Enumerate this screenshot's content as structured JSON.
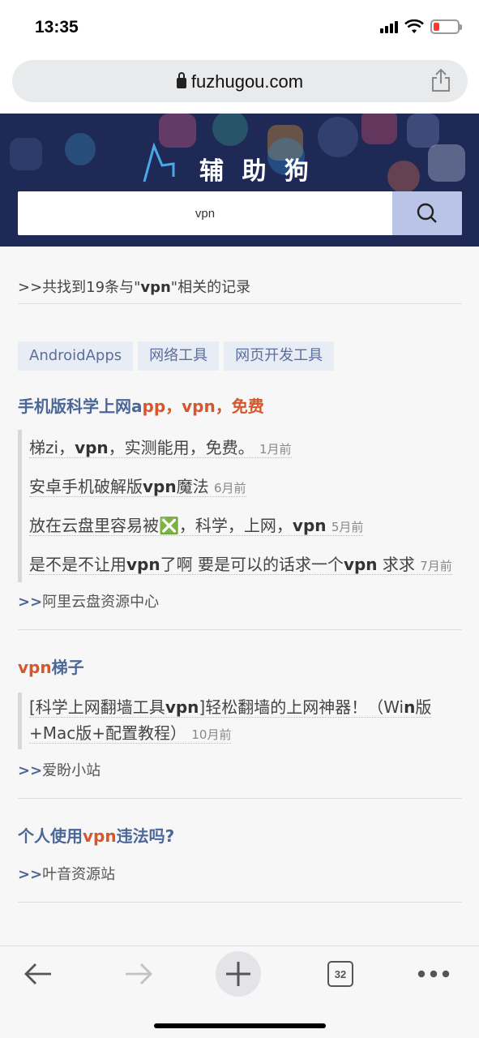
{
  "status": {
    "time": "13:35"
  },
  "browser": {
    "url": "fuzhugou.com",
    "tab_count": "32"
  },
  "site": {
    "brand": "辅 助 狗"
  },
  "search": {
    "value": "vpn"
  },
  "result_count": {
    "prefix": ">>共找到19条与\"",
    "keyword": "vpn",
    "suffix": "\"相关的记录"
  },
  "tags": [
    "AndroidApps",
    "网络工具",
    "网页开发工具"
  ],
  "sections": [
    {
      "title_parts": [
        "手机版科学上网a",
        "pp，vpn，免费"
      ],
      "items": [
        {
          "pre": "梯zi，",
          "kw": "vpn",
          "post": "，实测能用，免费。",
          "age": "1月前"
        },
        {
          "pre": "安卓手机破解版",
          "kw": "vpn",
          "post": "魔法",
          "age": "6月前"
        },
        {
          "pre": "放在云盘里容易被",
          "emoji": "❎",
          "post2": "，科学，上网，",
          "kw": "vpn",
          "age": "5月前"
        },
        {
          "pre": "是不是不让用",
          "kw": "vpn",
          "mid": "了啊 要是可以的话求一个",
          "kw2": "vpn",
          "post": " 求求",
          "age": "7月前"
        }
      ],
      "source_arrow": ">>",
      "source": "阿里云盘资源中心"
    },
    {
      "title_hl": "vpn",
      "title_rest": "梯子",
      "items": [
        {
          "pre": "[科学上网翻墙工具",
          "kw": "vpn",
          "mid": "]轻松翻墙的上网神器！（Wi",
          "kw2": "n",
          "post": "版+Mac版+配置教程）",
          "age": "10月前"
        }
      ],
      "source_arrow": ">>",
      "source": "爱盼小站"
    },
    {
      "title_pre": "个人使用",
      "title_hl": "vpn",
      "title_post": "违法吗?",
      "source_arrow": ">>",
      "source": "叶音资源站"
    }
  ],
  "colors": {
    "banner": "#1e2a55",
    "accent": "#d5572b",
    "link": "#4b6797"
  },
  "icons": [
    "lock-icon",
    "share-icon",
    "search-icon",
    "back-icon",
    "forward-icon",
    "new-tab-icon",
    "tabs-icon",
    "more-icon"
  ]
}
